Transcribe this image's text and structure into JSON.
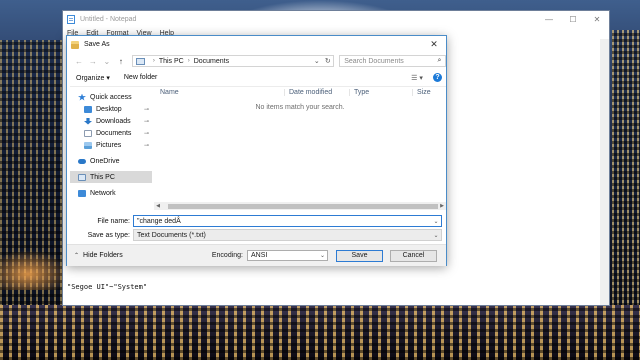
{
  "notepad": {
    "title": "Untitled - Notepad",
    "controls": {
      "minimize": "—",
      "maximize": "☐",
      "close": "✕"
    },
    "menu": [
      "File",
      "Edit",
      "Format",
      "View",
      "Help"
    ],
    "content_text": "\"Segoe UI\"~\"System\""
  },
  "dialog": {
    "title": "Save As",
    "close_glyph": "✕",
    "nav": {
      "back": "←",
      "forward": "→",
      "dropdown": "⌄",
      "up": "↑"
    },
    "breadcrumb": [
      "This PC",
      "Documents"
    ],
    "breadcrumb_separator": "›",
    "address_dropdown": "⌄",
    "refresh": "↻",
    "search_placeholder": "Search Documents",
    "search_glyph": "⌕",
    "toolbar": {
      "organize": "Organize ▾",
      "new_folder": "New folder",
      "view_glyph": "☰ ▾",
      "help_glyph": "?"
    },
    "nav_pane": {
      "quick_access": "Quick access",
      "items": [
        {
          "label": "Desktop",
          "pin": "📌",
          "color": "#3d8ad8"
        },
        {
          "label": "Downloads",
          "pin": "📌",
          "color": "#2a78c8"
        },
        {
          "label": "Documents",
          "pin": "📌",
          "color": "#8c9bb0"
        },
        {
          "label": "Pictures",
          "pin": "📌",
          "color": "#5a9fd8"
        }
      ],
      "onedrive": "OneDrive",
      "this_pc": "This PC",
      "network": "Network"
    },
    "columns": [
      "Name",
      "Date modified",
      "Type",
      "Size"
    ],
    "empty_message": "No items match your search.",
    "scroll_left": "◀",
    "scroll_right": "▶",
    "file_name_label": "File name:",
    "file_name_value": "\"change dedÂ",
    "save_as_type_label": "Save as type:",
    "save_as_type_value": "Text Documents (*.txt)",
    "hide_folders": "Hide Folders",
    "encoding_label": "Encoding:",
    "encoding_value": "ANSI",
    "save_button": "Save",
    "cancel_button": "Cancel",
    "dropdown_glyph": "⌄"
  },
  "colors": {
    "accent": "#2d7bd3",
    "selected_nav": "#d9d9d9",
    "help": "#1c7ad8"
  }
}
